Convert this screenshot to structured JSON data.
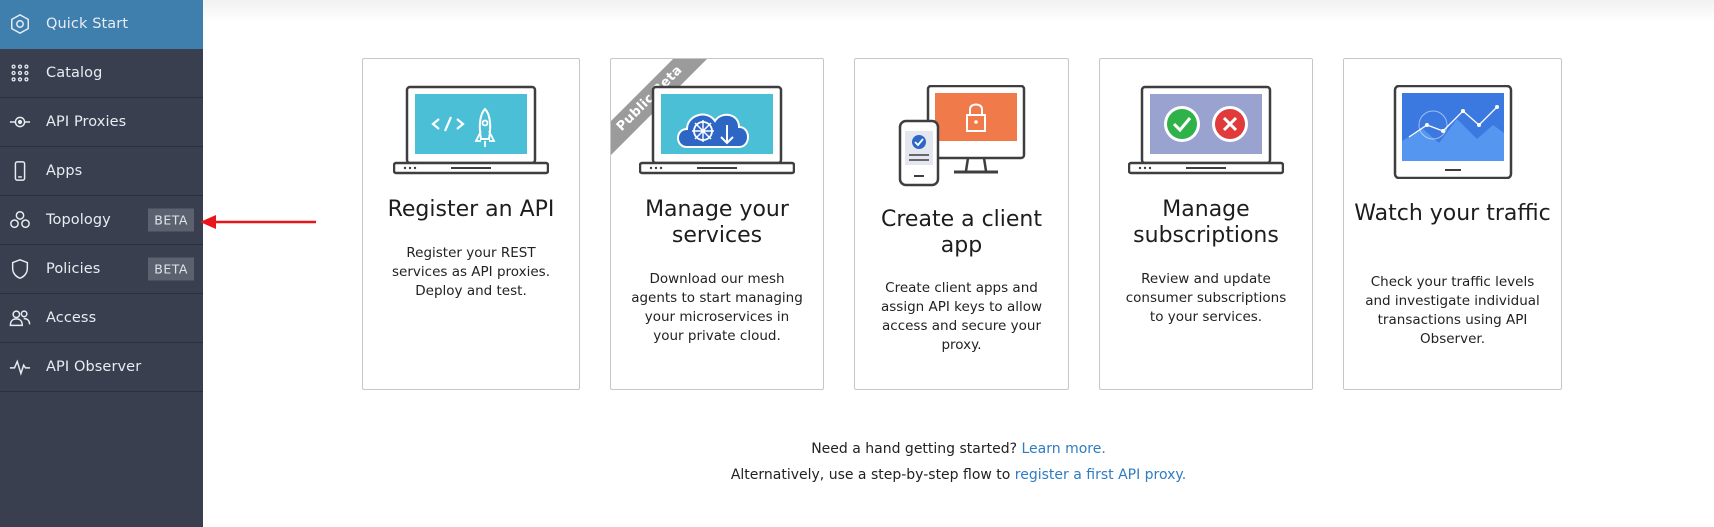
{
  "sidebar": {
    "items": [
      {
        "label": "Quick Start",
        "icon": "quick-start-icon",
        "active": true
      },
      {
        "label": "Catalog",
        "icon": "grid-icon"
      },
      {
        "label": "API Proxies",
        "icon": "api-proxy-icon"
      },
      {
        "label": "Apps",
        "icon": "phone-icon"
      },
      {
        "label": "Topology",
        "icon": "topology-icon",
        "badge": "BETA"
      },
      {
        "label": "Policies",
        "icon": "shield-icon",
        "badge": "BETA"
      },
      {
        "label": "Access",
        "icon": "users-icon"
      },
      {
        "label": "API Observer",
        "icon": "pulse-icon"
      }
    ]
  },
  "cards": [
    {
      "title": "Register an API",
      "description": "Register your REST services as API proxies. Deploy and test.",
      "icon": "laptop-rocket-icon"
    },
    {
      "title": "Manage your services",
      "description": "Download our mesh agents to start managing your microservices in your private cloud.",
      "icon": "laptop-cloud-icon",
      "ribbon": "Public Beta"
    },
    {
      "title": "Create a client app",
      "description": "Create client apps and assign API keys to allow access and secure your proxy.",
      "icon": "monitor-lock-icon"
    },
    {
      "title": "Manage subscriptions",
      "description": "Review and update consumer subscriptions to your services.",
      "icon": "laptop-check-cross-icon"
    },
    {
      "title": "Watch your traffic",
      "description": "Check your traffic levels and investigate individual transactions using API Observer.",
      "icon": "laptop-chart-icon"
    }
  ],
  "footer": {
    "help_text": "Need a hand getting started?",
    "learn_more_link": "Learn more.",
    "alt_text": "Alternatively, use a step-by-step flow to",
    "register_link": "register a first API proxy."
  },
  "colors": {
    "sidebar_bg": "#3a3f4f",
    "active_item": "#3f7fae",
    "link": "#2f7cc1",
    "annotation_arrow": "#e8161b",
    "screen_cyan": "#4bbfd6",
    "screen_orange": "#f07a4a",
    "screen_lavender": "#9aa2cf",
    "screen_blue": "#3b78e0"
  }
}
